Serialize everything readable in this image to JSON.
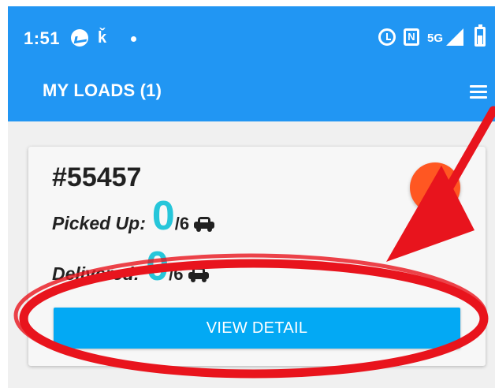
{
  "status_bar": {
    "time": "1:51",
    "network": "5G",
    "icons": [
      "messenger-icon",
      "teams-icon",
      "notification-dot",
      "alarm-icon",
      "nfc-icon",
      "signal-icon",
      "battery-icon"
    ]
  },
  "app_bar": {
    "title": "MY LOADS (1)",
    "menu_icon": "hamburger-menu-icon"
  },
  "load_card": {
    "id": "#55457",
    "picked_up": {
      "label": "Picked Up:",
      "count": "0",
      "total": "/6",
      "icon": "car-icon"
    },
    "delivered": {
      "label": "Delivered:",
      "count": "0",
      "total": "/6",
      "icon": "car-icon"
    },
    "more_icon": "more-vertical-icon",
    "button_label": "VIEW DETAIL"
  },
  "annotation": {
    "color": "#e8141d",
    "shapes": [
      "arrow",
      "ellipse"
    ]
  },
  "colors": {
    "primary": "#2196f3",
    "button": "#03a9f4",
    "accent_fab": "#ff5722",
    "count": "#26c6da"
  }
}
